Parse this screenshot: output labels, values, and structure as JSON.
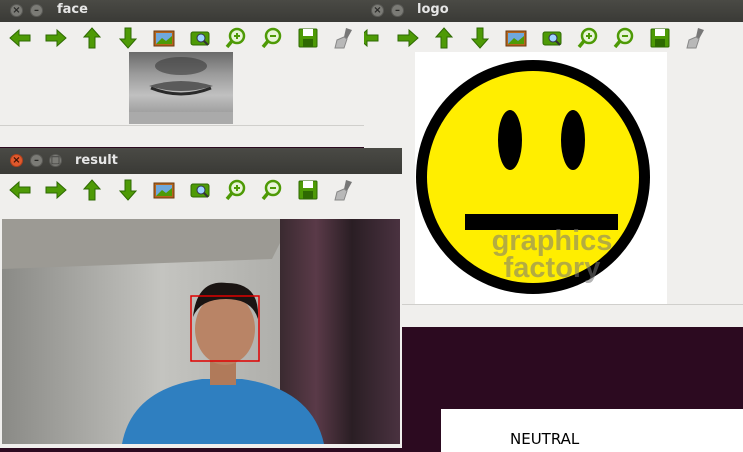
{
  "windows": {
    "face": {
      "title": "face"
    },
    "logo": {
      "title": "logo",
      "watermark": "graphics factory"
    },
    "result": {
      "title": "result"
    }
  },
  "toolbar_icons": [
    "arrow-left-icon",
    "arrow-right-icon",
    "arrow-up-icon",
    "arrow-down-icon",
    "save-image-icon",
    "properties-icon",
    "zoom-in-icon",
    "zoom-out-icon",
    "save-icon",
    "clear-brush-icon"
  ],
  "emotion_label": {
    "text": "NEUTRAL"
  },
  "colors": {
    "accent_green": "#4e9a06",
    "detection_box": "#e00000",
    "desktop": "#2c0a20",
    "smiley_yellow": "#ffee00"
  }
}
